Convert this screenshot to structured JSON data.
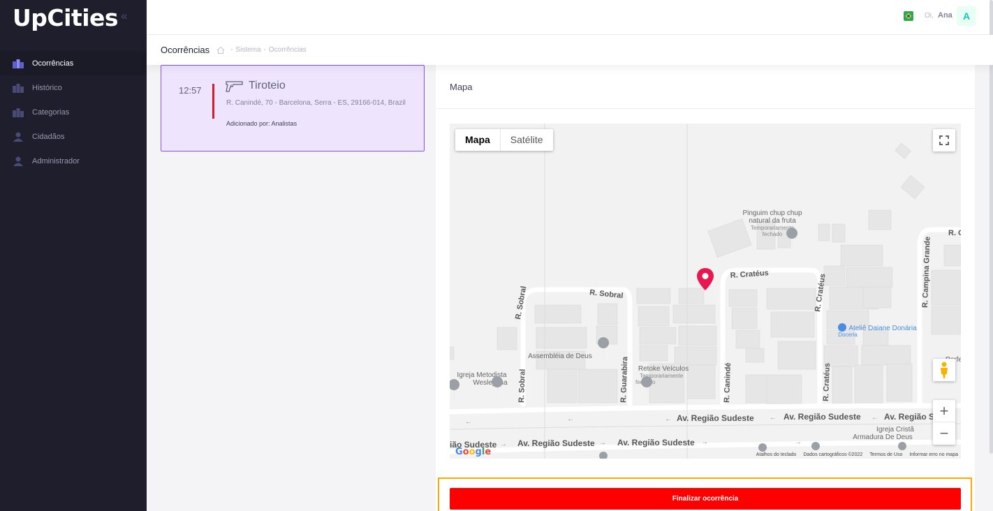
{
  "app": {
    "logo": "UpCities",
    "collapse_glyph": "«"
  },
  "sidebar": {
    "items": [
      {
        "label": "Ocorrências",
        "icon": "occurrences-icon",
        "active": true
      },
      {
        "label": "Histórico",
        "icon": "history-icon"
      },
      {
        "label": "Categorias",
        "icon": "categories-icon"
      },
      {
        "label": "Cidadãos",
        "icon": "citizens-icon"
      },
      {
        "label": "Administrador",
        "icon": "admin-icon"
      }
    ]
  },
  "header": {
    "greeting": "Oi,",
    "user_name": "Ana",
    "avatar_initial": "A",
    "flag": "brazil-flag-icon"
  },
  "subheader": {
    "title": "Ocorrências",
    "breadcrumb": [
      "Sistema",
      "Ocorrências"
    ],
    "separator": "-"
  },
  "occurrence": {
    "time": "12:57",
    "title": "Tiroteio",
    "icon": "gun-icon",
    "address": "R. Canindé, 70 - Barcelona, Serra - ES, 29166-014, Brazil",
    "added_by": "Adicionado por: Analistas",
    "accent_color": "#d41c2a"
  },
  "map": {
    "panel_title": "Mapa",
    "type_options": [
      "Mapa",
      "Satélite"
    ],
    "selected_type": "Mapa",
    "zoom_in": "+",
    "zoom_out": "−",
    "attribution": "Google",
    "footer_links": [
      "Atalhos do teclado",
      "Dados cartográficos ©2022",
      "Termos de Uso",
      "Informar erro no mapa"
    ],
    "labels": {
      "sobral1": "R. Sobral",
      "sobral2": "R. Sobral",
      "sobral3": "R. Sobral",
      "crateus1": "R. Cratéus",
      "crateus2": "R. Cratéus",
      "crateus3": "R. Cratéus",
      "guarabira": "R. Guarabira",
      "caninde": "R. Canindé",
      "campina": "R. Campina Grande",
      "rcut": "R. C",
      "av1": "Av. Região Sudeste",
      "av2": "Av. Região Sudeste",
      "av3": "Av. Região S",
      "av4": "Av. Região Sudeste",
      "av5": "Av. Região Sudeste",
      "av6": "ião Sudeste",
      "pinguim1": "Pinguim chup chup",
      "pinguim2": "natural da fruta",
      "pinguim3": "Temporariamente",
      "pinguim4": "fechado",
      "assembleia": "Assembléia de Deus",
      "retoke1": "Retoke Veículos",
      "retoke2": "Temporariamente",
      "retoke3": "fechado",
      "igreja1": "Igreja Metodista",
      "igreja2": "Wesleyana",
      "atelie1": "Ateliê Daiane Donária",
      "atelie2": "Doceria",
      "crista1": "Igreja Cristã",
      "crista2": "Armadura De Deus",
      "perfe": "Perfe"
    }
  },
  "actions": {
    "finalize": "Finalizar ocorrência",
    "finalize_color": "#ff0000"
  }
}
